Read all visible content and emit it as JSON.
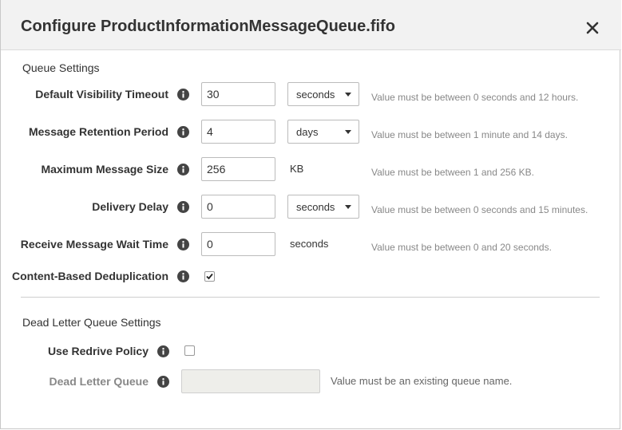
{
  "dialog": {
    "title": "Configure ProductInformationMessageQueue.fifo",
    "close_icon": "close-icon"
  },
  "queue_settings": {
    "section_title": "Queue Settings",
    "visibility_timeout": {
      "label": "Default Visibility Timeout",
      "value": "30",
      "unit": "seconds",
      "hint": "Value must be between 0 seconds and 12 hours."
    },
    "retention_period": {
      "label": "Message Retention Period",
      "value": "4",
      "unit": "days",
      "hint": "Value must be between 1 minute and 14 days."
    },
    "max_message_size": {
      "label": "Maximum Message Size",
      "value": "256",
      "unit": "KB",
      "hint": "Value must be between 1 and 256 KB."
    },
    "delivery_delay": {
      "label": "Delivery Delay",
      "value": "0",
      "unit": "seconds",
      "hint": "Value must be between 0 seconds and 15 minutes."
    },
    "receive_wait_time": {
      "label": "Receive Message Wait Time",
      "value": "0",
      "unit": "seconds",
      "hint": "Value must be between 0 and 20 seconds."
    },
    "content_dedup": {
      "label": "Content-Based Deduplication",
      "checked": true
    }
  },
  "dead_letter_settings": {
    "section_title": "Dead Letter Queue Settings",
    "use_redrive": {
      "label": "Use Redrive Policy",
      "checked": false
    },
    "dead_letter_queue": {
      "label": "Dead Letter Queue",
      "value": "",
      "hint": "Value must be an existing queue name.",
      "disabled": true
    }
  },
  "icons": {
    "info": "info-icon",
    "caret": "chevron-down-icon",
    "check": "check-icon"
  }
}
